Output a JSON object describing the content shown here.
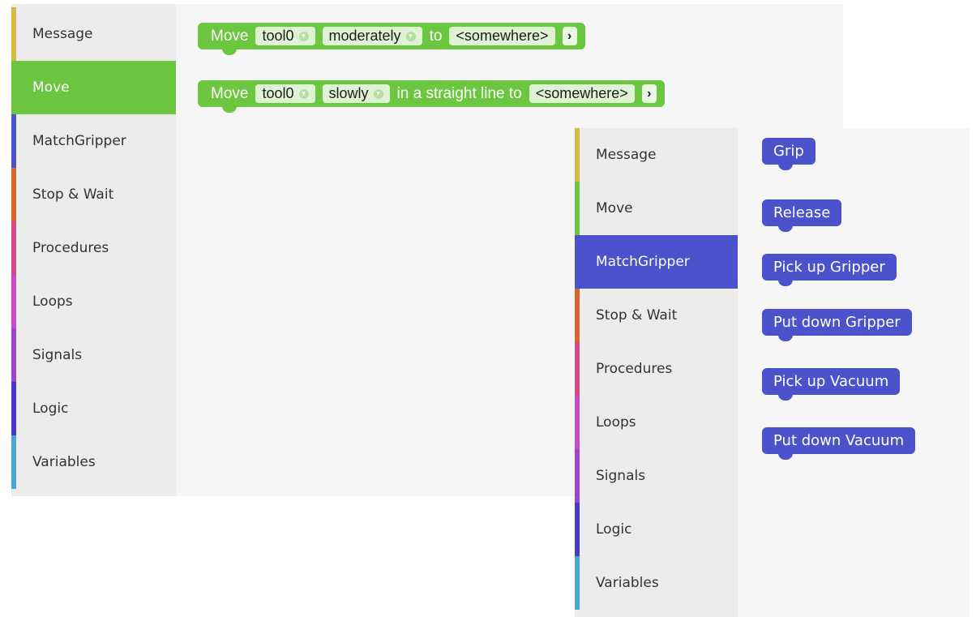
{
  "colors": {
    "message": "#d6b844",
    "move": "#6cc640",
    "matchgripper": "#4b52cc",
    "stop_wait": "#d9642e",
    "procedures": "#d24a86",
    "loops": "#c94ac9",
    "signals": "#9b46c9",
    "logic": "#4937c6",
    "variables": "#4aa6d3"
  },
  "left_panel": {
    "toolbox": [
      {
        "label": "Message",
        "color_key": "message"
      },
      {
        "label": "Move",
        "color_key": "move"
      },
      {
        "label": "MatchGripper",
        "color_key": "matchgripper"
      },
      {
        "label": "Stop & Wait",
        "color_key": "stop_wait"
      },
      {
        "label": "Procedures",
        "color_key": "procedures"
      },
      {
        "label": "Loops",
        "color_key": "loops"
      },
      {
        "label": "Signals",
        "color_key": "signals"
      },
      {
        "label": "Logic",
        "color_key": "logic"
      },
      {
        "label": "Variables",
        "color_key": "variables"
      }
    ],
    "selected": "Move",
    "blocks": {
      "move1": {
        "word": "Move",
        "tool": "tool0",
        "speed": "moderately",
        "connector": "to",
        "target": "<somewhere>",
        "chevron": "›"
      },
      "move2": {
        "word": "Move",
        "tool": "tool0",
        "speed": "slowly",
        "connector": "in a straight line to",
        "target": "<somewhere>",
        "chevron": "›"
      }
    },
    "dropdown_glyph": "▾"
  },
  "right_panel": {
    "toolbox": [
      {
        "label": "Message",
        "color_key": "message"
      },
      {
        "label": "Move",
        "color_key": "move"
      },
      {
        "label": "MatchGripper",
        "color_key": "matchgripper"
      },
      {
        "label": "Stop & Wait",
        "color_key": "stop_wait"
      },
      {
        "label": "Procedures",
        "color_key": "procedures"
      },
      {
        "label": "Loops",
        "color_key": "loops"
      },
      {
        "label": "Signals",
        "color_key": "signals"
      },
      {
        "label": "Logic",
        "color_key": "logic"
      },
      {
        "label": "Variables",
        "color_key": "variables"
      }
    ],
    "selected": "MatchGripper",
    "blocks": [
      "Grip",
      "Release",
      "Pick up Gripper",
      "Put down Gripper",
      "Pick up Vacuum",
      "Put down Vacuum"
    ]
  }
}
